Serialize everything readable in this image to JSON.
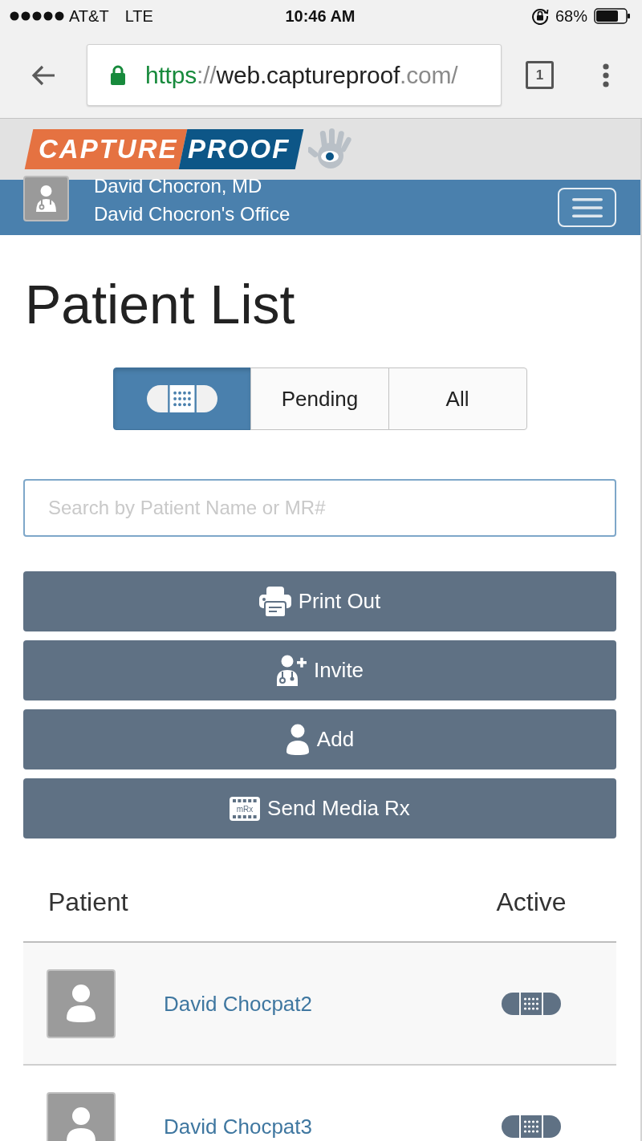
{
  "status_bar": {
    "carrier": "AT&T",
    "network": "LTE",
    "time": "10:46 AM",
    "battery": "68%"
  },
  "browser": {
    "url": [
      {
        "text": "https",
        "kind": "scheme"
      },
      {
        "text": "://",
        "kind": "dim"
      },
      {
        "text": "web.captureproof",
        "kind": "host"
      },
      {
        "text": ".com/",
        "kind": "dim"
      }
    ],
    "tab_count": "1"
  },
  "logo": {
    "left": "CAPTURE",
    "right": "PROOF"
  },
  "header": {
    "name": "David Chocron, MD",
    "office": "David Chocron's Office"
  },
  "title": "Patient List",
  "filter_tabs": [
    {
      "kind": "icon",
      "selected": true
    },
    {
      "kind": "text",
      "label": "Pending",
      "selected": false
    },
    {
      "kind": "text",
      "label": "All",
      "selected": false
    }
  ],
  "search": {
    "placeholder": "Search by Patient Name or MR#"
  },
  "actions": [
    {
      "kind": "print",
      "label": "Print Out"
    },
    {
      "kind": "invite",
      "label": "Invite"
    },
    {
      "kind": "add",
      "label": "Add"
    },
    {
      "kind": "media_rx",
      "label": "Send Media Rx",
      "icon_text": "mRx"
    }
  ],
  "table": {
    "columns": [
      "Patient",
      "Active"
    ],
    "rows": [
      {
        "name": "David Chocpat2",
        "active": true
      },
      {
        "name": "David Chocpat3",
        "active": true
      }
    ]
  }
}
